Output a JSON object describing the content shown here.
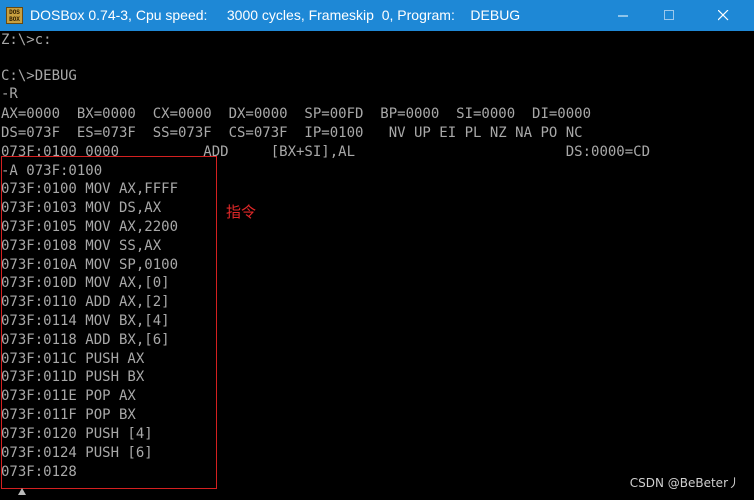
{
  "window": {
    "title": "DOSBox 0.74-3, Cpu speed:     3000 cycles, Frameskip  0, Program:    DEBUG",
    "icon_top": "DOS",
    "icon_bottom": "BOX"
  },
  "console": {
    "lines": [
      "Z:\\>c:",
      "",
      "C:\\>DEBUG",
      "-R",
      "AX=0000  BX=0000  CX=0000  DX=0000  SP=00FD  BP=0000  SI=0000  DI=0000",
      "DS=073F  ES=073F  SS=073F  CS=073F  IP=0100   NV UP EI PL NZ NA PO NC",
      "073F:0100 0000          ADD     [BX+SI],AL                         DS:0000=CD",
      "-A 073F:0100",
      "073F:0100 MOV AX,FFFF",
      "073F:0103 MOV DS,AX",
      "073F:0105 MOV AX,2200",
      "073F:0108 MOV SS,AX",
      "073F:010A MOV SP,0100",
      "073F:010D MOV AX,[0]",
      "073F:0110 ADD AX,[2]",
      "073F:0114 MOV BX,[4]",
      "073F:0118 ADD BX,[6]",
      "073F:011C PUSH AX",
      "073F:011D PUSH BX",
      "073F:011E POP AX",
      "073F:011F POP BX",
      "073F:0120 PUSH [4]",
      "073F:0124 PUSH [6]",
      "073F:0128"
    ]
  },
  "annotation": {
    "label": "指令",
    "color": "#d42020"
  },
  "watermark": "CSDN @BeBeter丿",
  "colors": {
    "titlebar": "#1e88d6",
    "console_text": "#a8a8a8",
    "console_bg": "#000000"
  },
  "icons": [
    "dosbox-app-icon",
    "minimize-icon",
    "maximize-icon",
    "close-icon"
  ]
}
